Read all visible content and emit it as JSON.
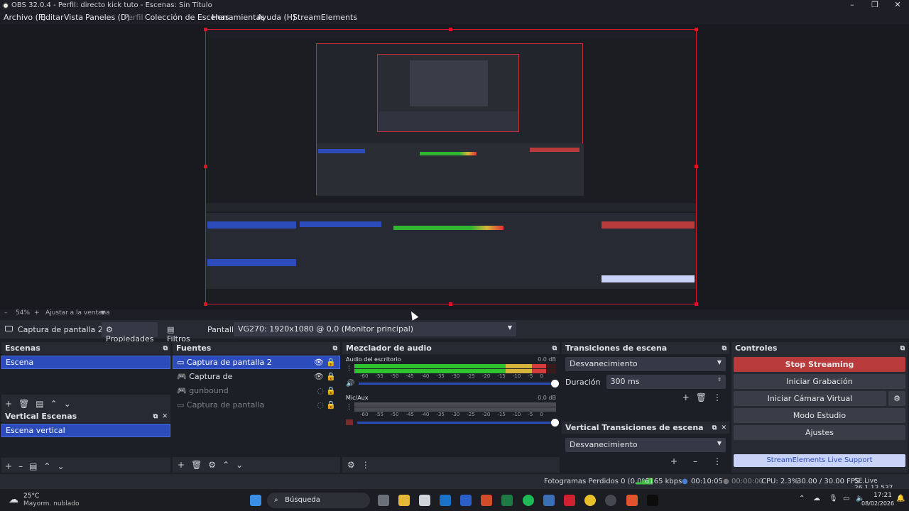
{
  "window": {
    "title": "OBS 32.0.4 - Perfil: directo kick tuto - Escenas: Sin Título",
    "controls": [
      "–",
      "❐",
      "✕"
    ]
  },
  "menu": [
    {
      "label": "Archivo (F)",
      "dim": false
    },
    {
      "label": "Editar",
      "dim": false
    },
    {
      "label": "Vista",
      "dim": false
    },
    {
      "label": "Paneles (D)",
      "dim": false
    },
    {
      "label": "Perfil",
      "dim": true
    },
    {
      "label": "Colección de Escenas",
      "dim": false
    },
    {
      "label": "Herramientas",
      "dim": false
    },
    {
      "label": "Ayuda (H)",
      "dim": false
    },
    {
      "label": "StreamElements",
      "dim": false
    }
  ],
  "zoom": {
    "minus": "–",
    "value": "54%",
    "plus": "+",
    "fit_label": "Ajustar a la ventana"
  },
  "source_toolbar": {
    "source_name": "Captura de pantalla 2",
    "properties": "Propiedades",
    "filters": "Filtros",
    "display_label": "Pantalla",
    "display_value": "VG270: 1920x1080 @ 0,0 (Monitor principal)"
  },
  "scenes": {
    "title": "Escenas",
    "items": [
      "Escena"
    ]
  },
  "vertical_scenes": {
    "title": "Vertical Escenas",
    "items": [
      "Escena vertical"
    ]
  },
  "sources": {
    "title": "Fuentes",
    "items": [
      {
        "name": "Captura de pantalla 2",
        "selected": true,
        "visible": true,
        "icon": "monitor-icon"
      },
      {
        "name": "Captura de",
        "selected": false,
        "visible": true,
        "icon": "gamepad-icon"
      },
      {
        "name": "gunbound",
        "selected": false,
        "visible": false,
        "icon": "gamepad-icon"
      },
      {
        "name": "Captura de pantalla",
        "selected": false,
        "visible": false,
        "icon": "monitor-icon"
      }
    ]
  },
  "mixer": {
    "title": "Mezclador de audio",
    "channels": [
      {
        "name": "Audio del escritorio",
        "db": "0.0 dB",
        "level": 0.95,
        "muted": false
      },
      {
        "name": "Mic/Aux",
        "db": "0.0 dB",
        "level": 0.0,
        "muted": true
      }
    ],
    "ticks": [
      "-60",
      "-55",
      "-50",
      "-45",
      "-40",
      "-35",
      "-30",
      "-25",
      "-20",
      "-15",
      "-10",
      "-5",
      "0"
    ]
  },
  "transitions": {
    "title": "Transiciones de escena",
    "selected": "Desvanecimiento",
    "duration_label": "Duración",
    "duration_value": "300 ms"
  },
  "vertical_transitions": {
    "title": "Vertical Transiciones de escena",
    "selected": "Desvanecimiento"
  },
  "controls": {
    "title": "Controles",
    "stop_streaming": "Stop Streaming",
    "start_recording": "Iniciar Grabación",
    "virtual_camera": "Iniciar Cámara Virtual",
    "studio_mode": "Modo Estudio",
    "settings": "Ajustes",
    "support": "StreamElements Live Support"
  },
  "status": {
    "dropped": "Fotogramas Perdidos 0 (0,0%)",
    "bitrate": "6165 kbps",
    "stream_time": "00:10:05",
    "rec_time": "00:00:00",
    "cpu": "CPU: 2.3%",
    "fps": "30.00 / 30.00 FPS",
    "se": "SE.Live 26.1.12.537"
  },
  "taskbar": {
    "weather_temp": "25°C",
    "weather_desc": "Mayorm. nublado",
    "search": "Búsqueda",
    "time": "17:21",
    "date": "08/02/2026"
  },
  "colors": {
    "accent": "#2c4cbb",
    "stop": "#b83a3a",
    "support": "#c9d3f7"
  }
}
